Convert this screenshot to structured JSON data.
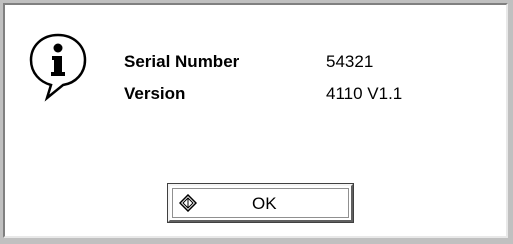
{
  "info": {
    "icon": "info-icon",
    "serial_label": "Serial Number",
    "serial_value": "54321",
    "version_label": "Version",
    "version_value": "4110 V1.1"
  },
  "buttons": {
    "ok_label": "OK",
    "ok_icon": "diamond-key-icon"
  }
}
